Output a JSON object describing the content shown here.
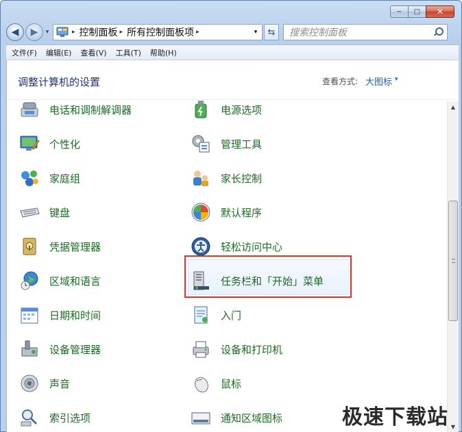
{
  "window": {
    "caption": {
      "min": "−",
      "max": "□",
      "close": "✕"
    }
  },
  "address_bar": {
    "crumbs": [
      "控制面板",
      "所有控制面板项"
    ],
    "separator": "▸",
    "dropdown": "▾"
  },
  "search": {
    "placeholder": "搜索控制面板"
  },
  "menu": [
    "文件(F)",
    "编辑(E)",
    "查看(V)",
    "工具(T)",
    "帮助(H)"
  ],
  "header": {
    "title": "调整计算机的设置",
    "view_by_label": "查看方式:",
    "view_by_value": "大图标",
    "view_caret": "▾"
  },
  "items": [
    {
      "label": "电话和调制解调器",
      "icon": "phone-modem-icon"
    },
    {
      "label": "电源选项",
      "icon": "power-options-icon"
    },
    {
      "label": "个性化",
      "icon": "personalization-icon"
    },
    {
      "label": "管理工具",
      "icon": "admin-tools-icon"
    },
    {
      "label": "家庭组",
      "icon": "homegroup-icon"
    },
    {
      "label": "家长控制",
      "icon": "parental-controls-icon"
    },
    {
      "label": "键盘",
      "icon": "keyboard-icon"
    },
    {
      "label": "默认程序",
      "icon": "default-programs-icon"
    },
    {
      "label": "凭据管理器",
      "icon": "credential-manager-icon"
    },
    {
      "label": "轻松访问中心",
      "icon": "ease-of-access-icon"
    },
    {
      "label": "区域和语言",
      "icon": "region-language-icon"
    },
    {
      "label": "任务栏和「开始」菜单",
      "icon": "taskbar-start-menu-icon"
    },
    {
      "label": "日期和时间",
      "icon": "date-time-icon"
    },
    {
      "label": "入门",
      "icon": "getting-started-icon"
    },
    {
      "label": "设备管理器",
      "icon": "device-manager-icon"
    },
    {
      "label": "设备和打印机",
      "icon": "devices-printers-icon"
    },
    {
      "label": "声音",
      "icon": "sound-icon"
    },
    {
      "label": "鼠标",
      "icon": "mouse-icon"
    },
    {
      "label": "索引选项",
      "icon": "indexing-options-icon"
    },
    {
      "label": "通知区域图标",
      "icon": "notification-area-icon"
    }
  ],
  "scrollbar": {
    "up": "▲",
    "down": "▼"
  },
  "watermark": "极速下载站",
  "colors": {
    "link_green": "#1d6a24",
    "title_blue": "#1e3287",
    "highlight_red": "#d9342c"
  }
}
